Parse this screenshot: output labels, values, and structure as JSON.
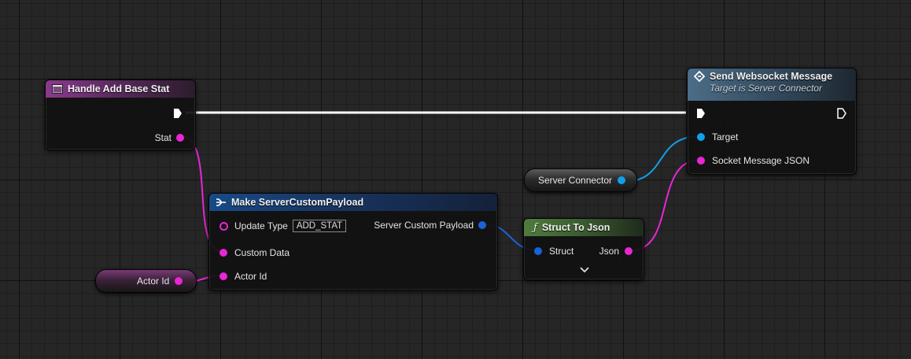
{
  "nodes": {
    "event": {
      "title": "Handle Add Base Stat",
      "stat_label": "Stat"
    },
    "send": {
      "title": "Send Websocket Message",
      "subtitle": "Target is Server Connector",
      "target_label": "Target",
      "socket_label": "Socket Message JSON"
    },
    "make": {
      "title": "Make ServerCustomPayload",
      "update_type_label": "Update Type",
      "update_type_value": "ADD_STAT",
      "output_label": "Server Custom Payload",
      "custom_data_label": "Custom Data",
      "actor_id_label": "Actor Id"
    },
    "to_json": {
      "title": "Struct To Json",
      "struct_label": "Struct",
      "json_label": "Json"
    },
    "server_connector": {
      "label": "Server Connector"
    },
    "actor_id_var": {
      "label": "Actor Id"
    }
  },
  "icons": [
    "event-icon",
    "function-icon",
    "struct-icon",
    "pure-function-icon",
    "expand-chevron-icon"
  ],
  "colors": {
    "exec": "#ffffff",
    "string_pin": "#e826d4",
    "object_pin": "#10a0e8",
    "struct_pin": "#1a62d6"
  }
}
